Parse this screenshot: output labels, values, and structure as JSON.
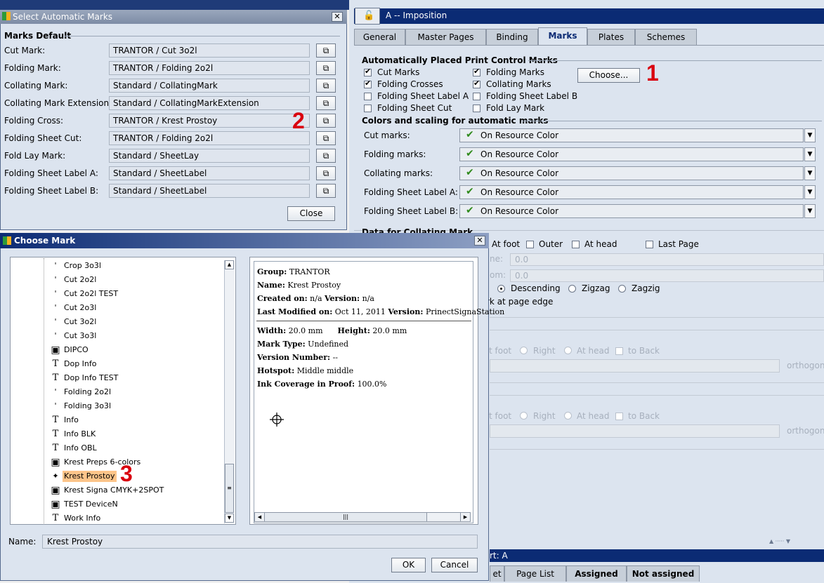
{
  "right_window": {
    "title": "A -- Imposition",
    "tabs": [
      "General",
      "Master Pages",
      "Binding",
      "Marks",
      "Plates",
      "Schemes"
    ],
    "active_tab": "Marks",
    "auto_section_title": "Automatically Placed Print Control Marks",
    "checkboxes": [
      {
        "label": "Cut Marks",
        "checked": true
      },
      {
        "label": "Folding Marks",
        "checked": true
      },
      {
        "label": "Folding Crosses",
        "checked": true
      },
      {
        "label": "Collating Marks",
        "checked": true
      },
      {
        "label": "Folding Sheet Label A",
        "checked": false
      },
      {
        "label": "Folding Sheet Label B",
        "checked": false
      },
      {
        "label": "Folding Sheet Cut",
        "checked": false
      },
      {
        "label": "Fold Lay Mark",
        "checked": false
      }
    ],
    "choose_button": "Choose...",
    "colors_section_title": "Colors and scaling for automatic marks",
    "color_rows": [
      {
        "label": "Cut marks:",
        "value": "On Resource Color"
      },
      {
        "label": "Folding marks:",
        "value": "On Resource Color"
      },
      {
        "label": "Collating marks:",
        "value": "On Resource Color"
      },
      {
        "label": "Folding Sheet Label A:",
        "value": "On Resource Color"
      },
      {
        "label": "Folding Sheet Label B:",
        "value": "On Resource Color"
      }
    ],
    "collating_section_title": "Data for Collating Mark",
    "collating_options": [
      "At foot",
      "Outer",
      "At head",
      "Last Page"
    ],
    "field_a_label": "ne:",
    "field_b_label": "om:",
    "field_value": "0.0",
    "order_options": [
      "Descending",
      "Zigzag",
      "Zagzig"
    ],
    "edge_text": "rk at page edge",
    "gray_opts": [
      "t foot",
      "Right",
      "At head",
      "to Back"
    ],
    "orthogonal": "orthogona",
    "bottom_title": "rt: A",
    "bottom_tabs": [
      "et",
      "Page List",
      "Assigned",
      "Not assigned"
    ]
  },
  "select_marks_dialog": {
    "title": "Select Automatic Marks",
    "close_x": "✕",
    "section_title": "Marks Default",
    "rows": [
      {
        "label": "Cut Mark:",
        "value": "TRANTOR / Cut 3o2l"
      },
      {
        "label": "Folding Mark:",
        "value": "TRANTOR / Folding 2o2l"
      },
      {
        "label": "Collating Mark:",
        "value": "Standard / CollatingMark"
      },
      {
        "label": "Collating Mark Extension:",
        "value": "Standard / CollatingMarkExtension"
      },
      {
        "label": "Folding Cross:",
        "value": "TRANTOR / Krest Prostoy"
      },
      {
        "label": "Folding Sheet Cut:",
        "value": "TRANTOR / Folding 2o2l"
      },
      {
        "label": "Fold Lay Mark:",
        "value": "Standard / SheetLay"
      },
      {
        "label": "Folding Sheet Label A:",
        "value": "Standard / SheetLabel"
      },
      {
        "label": "Folding Sheet Label B:",
        "value": "Standard / SheetLabel"
      }
    ],
    "close_button": "Close"
  },
  "choose_mark_dialog": {
    "title": "Choose Mark",
    "close_x": "✕",
    "tree_items": [
      {
        "label": "Crop 3o3l",
        "icon": "'"
      },
      {
        "label": "Cut 2o2l",
        "icon": "'"
      },
      {
        "label": "Cut 2o2l TEST",
        "icon": "'"
      },
      {
        "label": "Cut 2o3l",
        "icon": "'"
      },
      {
        "label": "Cut 3o2l",
        "icon": "'"
      },
      {
        "label": "Cut 3o3l",
        "icon": "'"
      },
      {
        "label": "DIPCO",
        "icon": "▣"
      },
      {
        "label": "Dop Info",
        "icon": "T"
      },
      {
        "label": "Dop Info TEST",
        "icon": "T"
      },
      {
        "label": "Folding 2o2l",
        "icon": "'"
      },
      {
        "label": "Folding 3o3l",
        "icon": "'"
      },
      {
        "label": "Info",
        "icon": "T"
      },
      {
        "label": "Info BLK",
        "icon": "T"
      },
      {
        "label": "Info OBL",
        "icon": "T"
      },
      {
        "label": "Krest Preps 6-colors",
        "icon": "▣"
      },
      {
        "label": "Krest Prostoy",
        "icon": "✦"
      },
      {
        "label": "Krest Signa CMYK+2SPOT",
        "icon": "▣"
      },
      {
        "label": "TEST DeviceN",
        "icon": "▣"
      },
      {
        "label": "Work Info",
        "icon": "T"
      }
    ],
    "selected": "Krest Prostoy",
    "info": {
      "group_label": "Group:",
      "group": "TRANTOR",
      "name_label": "Name:",
      "name": "Krest Prostoy",
      "created_label": "Created on:",
      "created": "n/a",
      "version_label": "Version:",
      "version": "n/a",
      "modified_label": "Last Modified on:",
      "modified": "Oct 11, 2011",
      "version2_label": "Version:",
      "version2": "PrinectSignaStation",
      "width_label": "Width:",
      "width": "20.0 mm",
      "height_label": "Height:",
      "height": "20.0 mm",
      "type_label": "Mark Type:",
      "type": "Undefined",
      "vnum_label": "Version Number:",
      "vnum": "--",
      "hotspot_label": "Hotspot:",
      "hotspot": "Middle middle",
      "ink_label": "Ink Coverage in Proof:",
      "ink": "100.0%"
    },
    "name_label": "Name:",
    "name_value": "Krest Prostoy",
    "ok_button": "OK",
    "cancel_button": "Cancel"
  },
  "annotations": {
    "one": "1",
    "two": "2",
    "three": "3"
  },
  "colors": {
    "titlebar": "#0b2b74",
    "panel": "#dce4ef",
    "annotation": "#d9000e",
    "selection": "#fdc58a"
  }
}
